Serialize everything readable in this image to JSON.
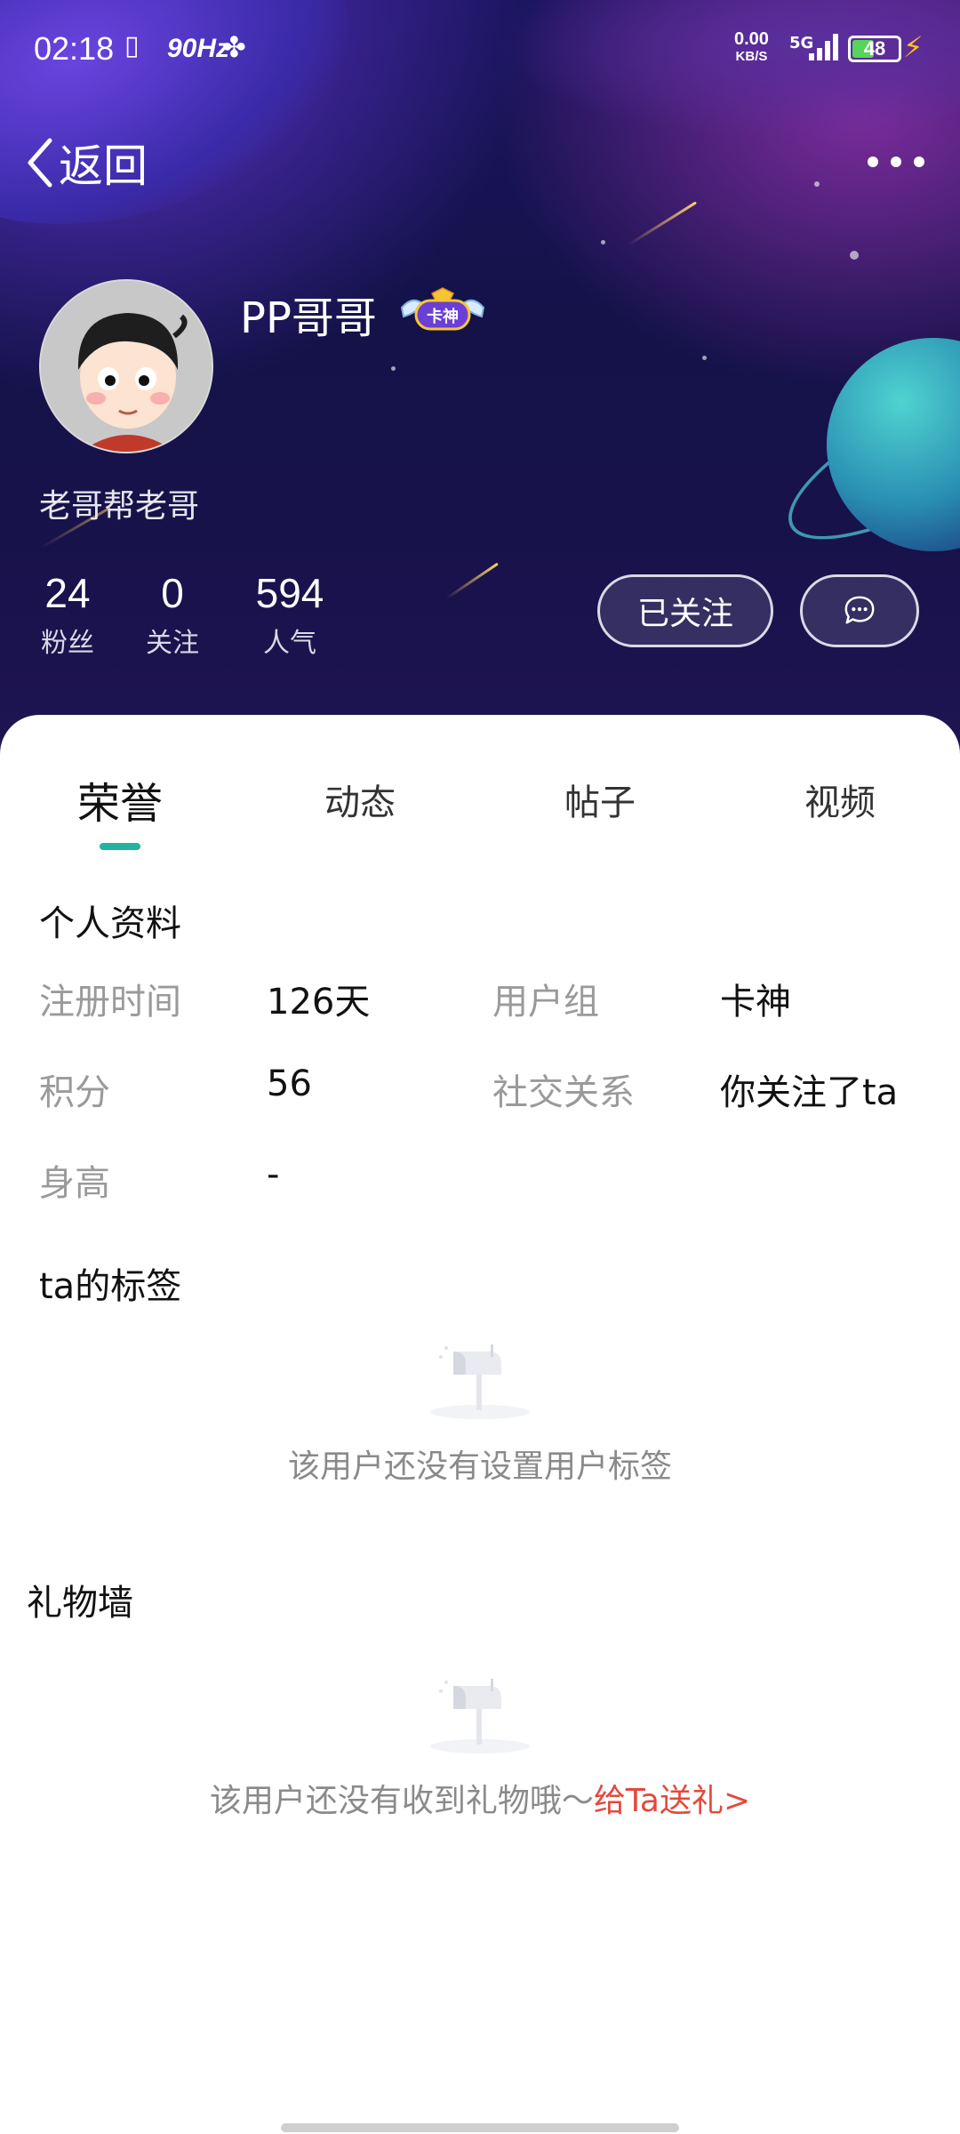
{
  "status_bar": {
    "time": "02:18",
    "refresh_rate": "90Hz",
    "net_speed_value": "0.00",
    "net_speed_unit": "KB/S",
    "network": "5G",
    "battery": "48",
    "battery_level": 0.48
  },
  "nav": {
    "back_label": "返回"
  },
  "profile": {
    "username": "PP哥哥",
    "badge_text": "卡神",
    "signature": "老哥帮老哥",
    "stats": [
      {
        "value": "24",
        "label": "粉丝"
      },
      {
        "value": "0",
        "label": "关注"
      },
      {
        "value": "594",
        "label": "人气"
      }
    ],
    "follow_button": "已关注"
  },
  "tabs": [
    {
      "label": "荣誉",
      "active": true
    },
    {
      "label": "动态",
      "active": false
    },
    {
      "label": "帖子",
      "active": false
    },
    {
      "label": "视频",
      "active": false
    }
  ],
  "personal_info": {
    "title": "个人资料",
    "fields": [
      {
        "label": "注册时间",
        "value": "126天"
      },
      {
        "label": "用户组",
        "value": "卡神"
      },
      {
        "label": "积分",
        "value": "56"
      },
      {
        "label": "社交关系",
        "value": "你关注了ta"
      },
      {
        "label": "身高",
        "value": "-"
      }
    ]
  },
  "tags_section": {
    "title": "ta的标签",
    "empty_message": "该用户还没有设置用户标签"
  },
  "gift_wall": {
    "title": "礼物墙",
    "empty_message": "该用户还没有收到礼物哦～",
    "send_gift_link": "给Ta送礼>"
  },
  "colors": {
    "accent_teal": "#24b3a0",
    "link_red": "#e4493c",
    "header_bg": "#141249"
  }
}
